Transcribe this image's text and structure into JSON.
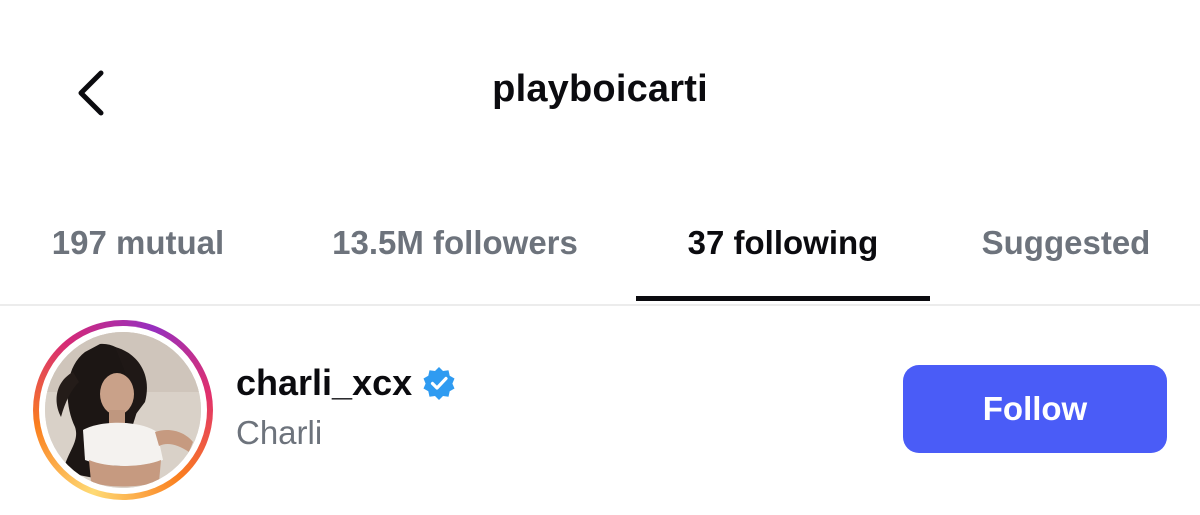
{
  "header": {
    "title": "playboicarti",
    "back_icon": "chevron-left-icon"
  },
  "tabs": [
    {
      "label": "197 mutual",
      "active": false
    },
    {
      "label": "13.5M followers",
      "active": false
    },
    {
      "label": "37 following",
      "active": true
    },
    {
      "label": "Suggested",
      "active": false
    }
  ],
  "list": {
    "items": [
      {
        "username": "charli_xcx",
        "full_name": "Charli",
        "verified": true,
        "verified_icon": "verified-badge-icon",
        "has_story_ring": true,
        "follow_label": "Follow"
      }
    ]
  },
  "colors": {
    "follow_button": "#4a5cf7",
    "verified_badge": "#2f9bf1",
    "muted_text": "#6d737c",
    "active_text": "#0b0b0f"
  }
}
